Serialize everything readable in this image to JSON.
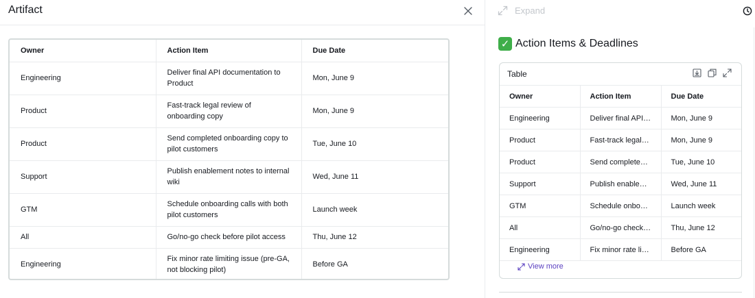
{
  "artifact": {
    "title": "Artifact",
    "columns": [
      "Owner",
      "Action Item",
      "Due Date"
    ],
    "rows": [
      {
        "owner": "Engineering",
        "action": "Deliver final API documentation to Product",
        "due": "Mon, June 9"
      },
      {
        "owner": "Product",
        "action": "Fast-track legal review of onboarding copy",
        "due": "Mon, June 9"
      },
      {
        "owner": "Product",
        "action": "Send completed onboarding copy to pilot customers",
        "due": "Tue, June 10"
      },
      {
        "owner": "Support",
        "action": "Publish enablement notes to internal wiki",
        "due": "Wed, June 11"
      },
      {
        "owner": "GTM",
        "action": "Schedule onboarding calls with both pilot customers",
        "due": "Launch week"
      },
      {
        "owner": "All",
        "action": "Go/no-go check before pilot access",
        "due": "Thu, June 12"
      },
      {
        "owner": "Engineering",
        "action": "Fix minor rate limiting issue (pre-GA, not blocking pilot)",
        "due": "Before GA"
      }
    ]
  },
  "chat": {
    "expand_label": "Expand",
    "heading": "Action Items & Deadlines",
    "heading_emoji": "✓",
    "card": {
      "title": "Table",
      "columns": [
        "Owner",
        "Action Item",
        "Due Date"
      ],
      "rows": [
        {
          "owner": "Engineering",
          "action": "Deliver final API documentation to Product",
          "due": "Mon, June 9"
        },
        {
          "owner": "Product",
          "action": "Fast-track legal review of onboarding copy",
          "due": "Mon, June 9"
        },
        {
          "owner": "Product",
          "action": "Send completed onboarding copy to pilot customers",
          "due": "Tue, June 10"
        },
        {
          "owner": "Support",
          "action": "Publish enablement notes to internal wiki",
          "due": "Wed, June 11"
        },
        {
          "owner": "GTM",
          "action": "Schedule onboarding calls with both pilot customers",
          "due": "Launch week"
        },
        {
          "owner": "All",
          "action": "Go/no-go check before pilot access",
          "due": "Thu, June 12"
        },
        {
          "owner": "Engineering",
          "action": "Fix minor rate limiting issue (pre-GA, not blocking pilot)",
          "due": "Before GA"
        }
      ],
      "view_more_label": "View more"
    }
  },
  "colors": {
    "link": "#5a3fc0",
    "check_green": "#3fae49",
    "border": "#d5dbdb"
  }
}
